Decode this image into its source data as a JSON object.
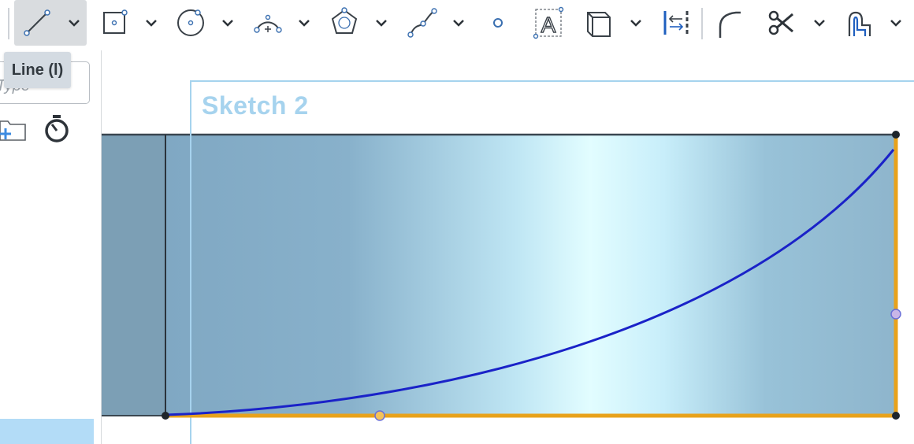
{
  "toolbar": {
    "tools": [
      {
        "name": "line-tool-button",
        "icon": "line-icon",
        "active": true,
        "has_dropdown": true
      },
      {
        "name": "rectangle-tool-button",
        "icon": "rectangle-icon",
        "has_dropdown": true
      },
      {
        "name": "circle-tool-button",
        "icon": "circle-icon",
        "has_dropdown": true
      },
      {
        "name": "arc-tool-button",
        "icon": "arc-icon",
        "has_dropdown": true
      },
      {
        "name": "polygon-tool-button",
        "icon": "polygon-icon",
        "has_dropdown": true
      },
      {
        "name": "spline-tool-button",
        "icon": "spline-icon",
        "has_dropdown": true
      },
      {
        "name": "point-tool-button",
        "icon": "point-icon",
        "has_dropdown": false
      },
      {
        "name": "text-tool-button",
        "icon": "sketch-text-icon",
        "has_dropdown": false
      },
      {
        "name": "construction-tool-button",
        "icon": "construction-box-icon",
        "has_dropdown": true
      },
      {
        "name": "constraint-tool-button",
        "icon": "dimension-constraint-icon",
        "has_dropdown": false
      },
      {
        "name": "fillet-tool-button",
        "icon": "sketch-fillet-icon",
        "has_dropdown": false
      },
      {
        "name": "trim-tool-button",
        "icon": "scissors-icon",
        "has_dropdown": true
      },
      {
        "name": "offset-tool-button",
        "icon": "offset-icon",
        "has_dropdown": true
      }
    ]
  },
  "tooltip": {
    "text": "Line (l)"
  },
  "left_panel": {
    "filter_placeholder": "Type",
    "icons": [
      "add-folder-icon",
      "stopwatch-icon"
    ]
  },
  "viewport": {
    "sketch_title": "Sketch 2",
    "colors": {
      "part_face": "#87acc4",
      "highlight": "#dffbff",
      "sketch_plane_outline": "#a6d3ee",
      "selected_edge": "#e8a21b",
      "spline": "#1a22c8",
      "part_edge": "#2f3a42"
    }
  }
}
